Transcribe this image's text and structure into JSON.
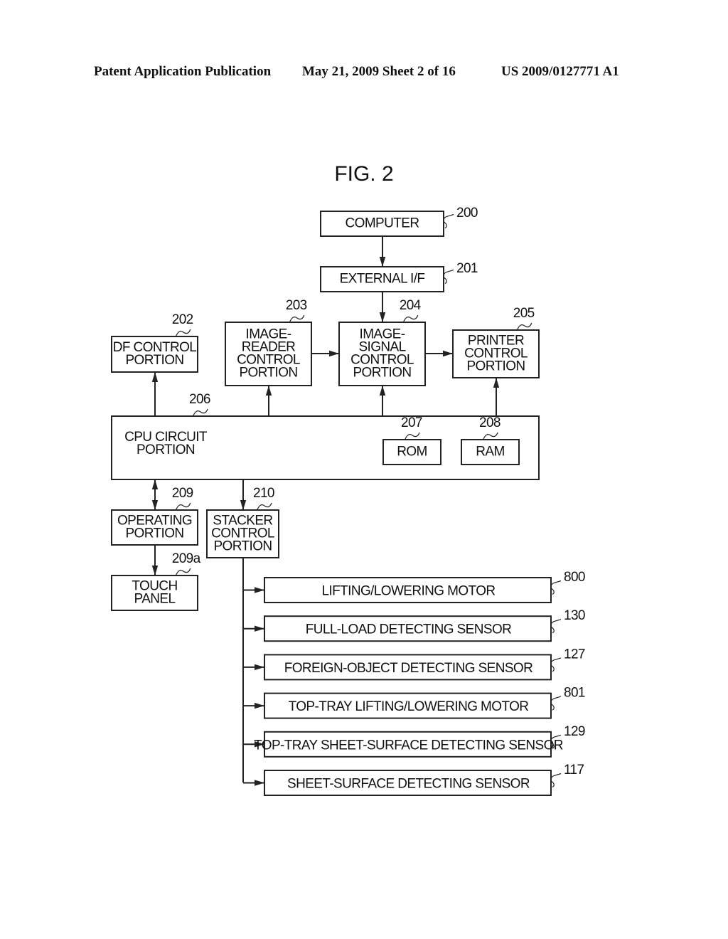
{
  "header": {
    "publication": "Patent Application Publication",
    "date_sheet": "May 21, 2009  Sheet 2 of 16",
    "patent_number": "US 2009/0127771 A1"
  },
  "figure": {
    "title": "FIG. 2"
  },
  "blocks": {
    "computer": {
      "lines": [
        "COMPUTER"
      ],
      "ref": "200"
    },
    "external_if": {
      "lines": [
        "EXTERNAL I/F"
      ],
      "ref": "201"
    },
    "df_control": {
      "lines": [
        "DF CONTROL",
        "PORTION"
      ],
      "ref": "202"
    },
    "image_reader": {
      "lines": [
        "IMAGE-",
        "READER",
        "CONTROL",
        "PORTION"
      ],
      "ref": "203"
    },
    "image_signal": {
      "lines": [
        "IMAGE-",
        "SIGNAL",
        "CONTROL",
        "PORTION"
      ],
      "ref": "204"
    },
    "printer_control": {
      "lines": [
        "PRINTER",
        "CONTROL",
        "PORTION"
      ],
      "ref": "205"
    },
    "cpu_circuit": {
      "lines": [
        "CPU CIRCUIT",
        "PORTION"
      ],
      "ref": "206"
    },
    "rom": {
      "lines": [
        "ROM"
      ],
      "ref": "207"
    },
    "ram": {
      "lines": [
        "RAM"
      ],
      "ref": "208"
    },
    "operating": {
      "lines": [
        "OPERATING",
        "PORTION"
      ],
      "ref": "209"
    },
    "touch_panel": {
      "lines": [
        "TOUCH",
        "PANEL"
      ],
      "ref": "209a"
    },
    "stacker_control": {
      "lines": [
        "STACKER",
        "CONTROL",
        "PORTION"
      ],
      "ref": "210"
    }
  },
  "stacker_outputs": [
    {
      "label": "LIFTING/LOWERING MOTOR",
      "ref": "800"
    },
    {
      "label": "FULL-LOAD DETECTING SENSOR",
      "ref": "130"
    },
    {
      "label": "FOREIGN-OBJECT DETECTING SENSOR",
      "ref": "127"
    },
    {
      "label": "TOP-TRAY LIFTING/LOWERING MOTOR",
      "ref": "801"
    },
    {
      "label": "TOP-TRAY SHEET-SURFACE DETECTING SENSOR",
      "ref": "129"
    },
    {
      "label": "SHEET-SURFACE DETECTING SENSOR",
      "ref": "117"
    }
  ]
}
